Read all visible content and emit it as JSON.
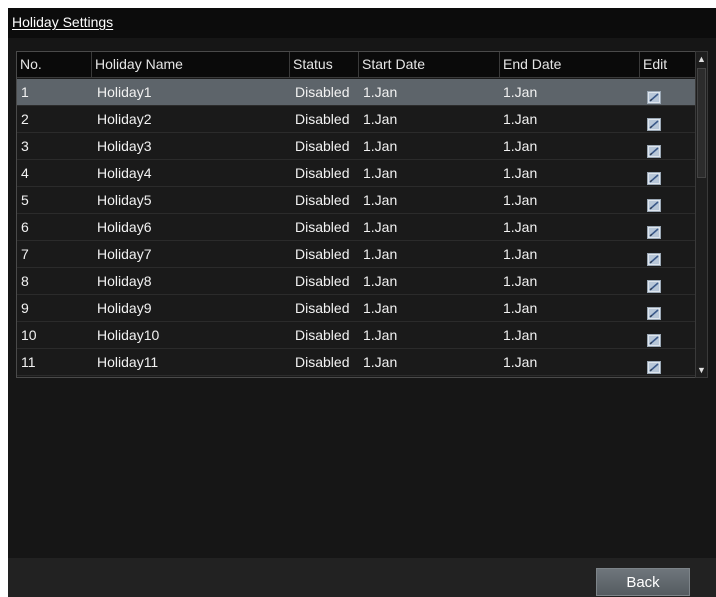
{
  "window": {
    "title": "Holiday Settings"
  },
  "table": {
    "columns": [
      "No.",
      "Holiday Name",
      "Status",
      "Start Date",
      "End Date",
      "Edit"
    ],
    "selected_row": 0,
    "rows": [
      {
        "no": "1",
        "name": "Holiday1",
        "status": "Disabled",
        "start": "1.Jan",
        "end": "1.Jan"
      },
      {
        "no": "2",
        "name": "Holiday2",
        "status": "Disabled",
        "start": "1.Jan",
        "end": "1.Jan"
      },
      {
        "no": "3",
        "name": "Holiday3",
        "status": "Disabled",
        "start": "1.Jan",
        "end": "1.Jan"
      },
      {
        "no": "4",
        "name": "Holiday4",
        "status": "Disabled",
        "start": "1.Jan",
        "end": "1.Jan"
      },
      {
        "no": "5",
        "name": "Holiday5",
        "status": "Disabled",
        "start": "1.Jan",
        "end": "1.Jan"
      },
      {
        "no": "6",
        "name": "Holiday6",
        "status": "Disabled",
        "start": "1.Jan",
        "end": "1.Jan"
      },
      {
        "no": "7",
        "name": "Holiday7",
        "status": "Disabled",
        "start": "1.Jan",
        "end": "1.Jan"
      },
      {
        "no": "8",
        "name": "Holiday8",
        "status": "Disabled",
        "start": "1.Jan",
        "end": "1.Jan"
      },
      {
        "no": "9",
        "name": "Holiday9",
        "status": "Disabled",
        "start": "1.Jan",
        "end": "1.Jan"
      },
      {
        "no": "10",
        "name": "Holiday10",
        "status": "Disabled",
        "start": "1.Jan",
        "end": "1.Jan"
      },
      {
        "no": "11",
        "name": "Holiday11",
        "status": "Disabled",
        "start": "1.Jan",
        "end": "1.Jan"
      }
    ],
    "edit_icon": "edit-icon"
  },
  "footer": {
    "back_label": "Back"
  },
  "colors": {
    "background": "#161616",
    "selected_row": "#5d646a",
    "text": "#f2f2f2",
    "button": "#62696e"
  }
}
